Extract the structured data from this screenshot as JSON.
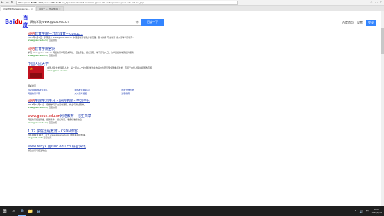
{
  "browser": {
    "url_prefix": "https://www.",
    "url_domain": "baidu.com",
    "url_rest": "/s?ie=utf-8&f=8&rsv_bp=1&tn=baidu&wd=www.gpsuc.edu.cn&oq=www.gpsuc.edu.cn&rsv_pq=...",
    "nav": {
      "back": "←",
      "forward": "→",
      "refresh": "↻"
    },
    "right_icons": [
      "☆",
      "⋯",
      "✕"
    ],
    "tabs": [
      {
        "label": "百度搜索Wwww.gpsuc.e...",
        "close": "×"
      },
      {
        "label": "百度一下，你就知道",
        "close": "×"
      }
    ]
  },
  "search": {
    "logo_a": "Bai",
    "logo_b": "du",
    "logo_c": "百度",
    "query": "网络学院 www.gpsuc.edu.cn",
    "camera_icon": "◉",
    "button": "百度一下",
    "header_links": [
      "百度首页",
      "设置"
    ],
    "login": "登录"
  },
  "results": [
    {
      "title_em": "网络",
      "title": "教育学院—开放教育-- gpsuc...",
      "desc": "2017年5月6日 · 学院简介 www.gpsuc.edu.cn 中网络教育学院办学历程，奋斗拼搏 开放教育 成人高等学历教育...",
      "url": "www.gpsuc.edu.cn/",
      "meta": "百度快照"
    },
    {
      "title_em": "网络",
      "title": "教育学院官网",
      "desc": "学院 www.gpsuc.edu.cn 网络教育学院官方网站，招生专业、报名流程、学习平台入口，为学员提供学历提升服务。",
      "url": "www.gpsuc.edu.cn/",
      "meta": "百度快照"
    },
    {
      "title_em": "",
      "title": "中国人民大学",
      "desc": "中国人民大学 简称人大，是一所以人文社会科学为主的综合性研究型全国重点大学，直属于中华人民共和国教育部。",
      "url": "www.gpsuc.edu.cn/",
      "meta": ""
    }
  ],
  "related": {
    "title": "相关搜索",
    "items": [
      "2020年网络教育报名",
      "网络教育报名入口",
      "国家开放大学",
      "网络教育学院",
      "成人高考报名",
      "远程教育"
    ]
  },
  "results2": [
    {
      "title_em": "网络",
      "title": "学院学习平台 - 网络学院 - 学习平台",
      "desc": "2018年10月12日 · 登录学习平台查看课程、作业与考试安排。",
      "url": "www.gpsuc.edu.cn/",
      "meta": "百度快照"
    },
    {
      "title_em": "www.gpsuc.edu.cn",
      "title": "网络教育 - 招生简章",
      "desc": "网络教育招生简章、报考条件、报名时间、收费标准等信息。",
      "url": "www.gpsuc.edu.cn/",
      "meta": "百度快照"
    },
    {
      "title_em": "",
      "title": "1.12 学院远程教育 - CSDN博客",
      "desc": "2019年2月12日 · 关于 www.gpsuc.edu.cn 的相关资料整理。",
      "url": "blog.csdn.net/",
      "meta": "百度快照"
    },
    {
      "title_em": "",
      "title": "www.fenyx.gpsuc.edu.cn 综合资讯",
      "desc": "综合资讯与招生动态。",
      "url": "",
      "meta": ""
    }
  ],
  "taskbar": {
    "start_icon": "⊞",
    "search_icon": "⌕",
    "apps": [
      "e",
      "📁",
      "⊞"
    ],
    "tray": [
      "⌃",
      "🔊",
      "中"
    ],
    "time": "9:22",
    "date": "2020/6/19"
  }
}
